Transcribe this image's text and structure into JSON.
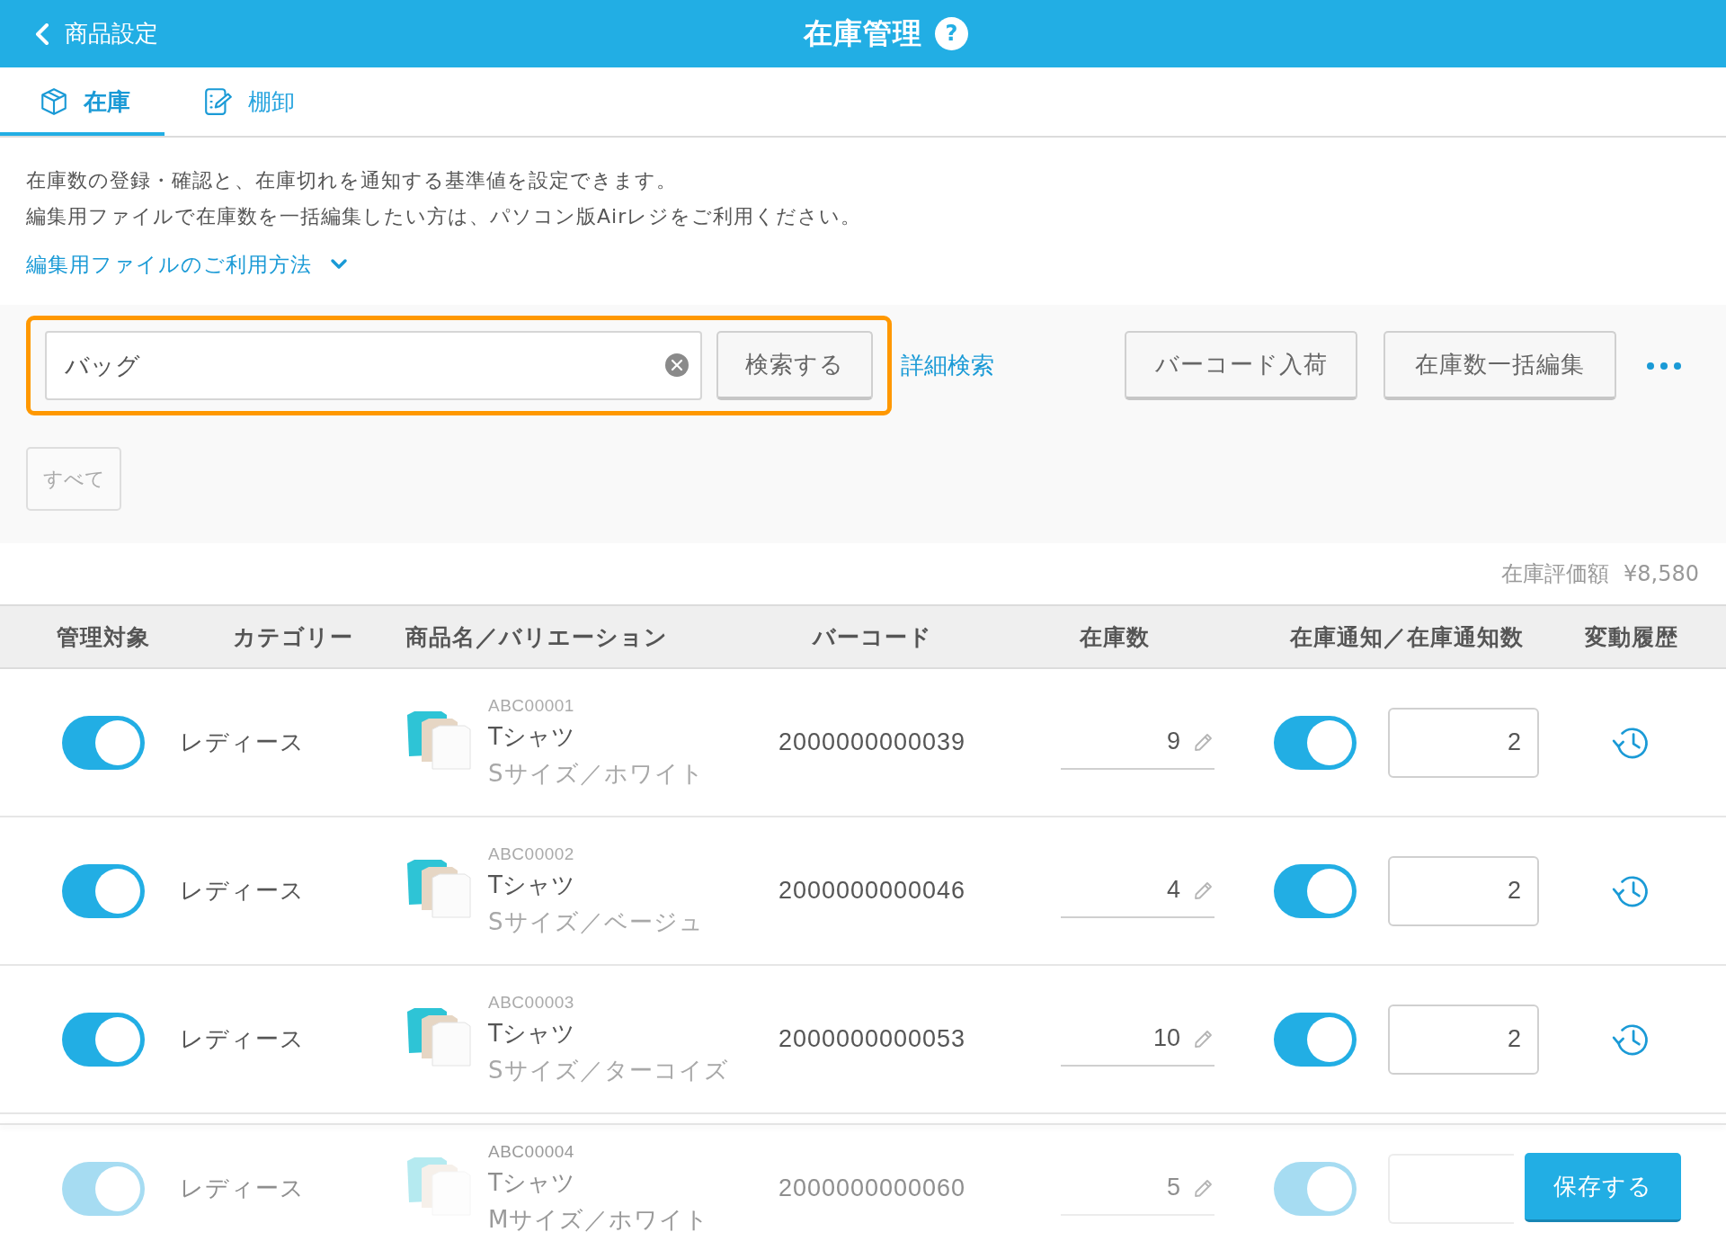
{
  "header": {
    "back": "商品設定",
    "title": "在庫管理",
    "help": "?"
  },
  "tabs": [
    {
      "label": "在庫",
      "selected": true
    },
    {
      "label": "棚卸",
      "selected": false
    }
  ],
  "description": [
    "在庫数の登録・確認と、在庫切れを通知する基準値を設定できます。",
    "編集用ファイルで在庫数を一括編集したい方は、パソコン版Airレジをご利用ください。"
  ],
  "help_link": {
    "label": "編集用ファイルのご利用方法",
    "expanded": false
  },
  "search": {
    "value": "バッグ",
    "button": "検索する",
    "highlighted": true
  },
  "advanced_search": "詳細検索",
  "actions": [
    "バーコード入荷",
    "在庫数一括編集"
  ],
  "filter_chips": [
    "すべて"
  ],
  "valuation": {
    "label": "在庫評価額",
    "amount": "¥8,580"
  },
  "table": {
    "columns": [
      "管理対象",
      "カテゴリー",
      "商品名／バリエーション",
      "バーコード",
      "在庫数",
      "在庫通知／在庫通知数",
      "変動履歴"
    ],
    "rows": [
      {
        "managed": true,
        "category": "レディース",
        "code": "ABC00001",
        "name": "Tシャツ",
        "variation": "Sサイズ／ホワイト",
        "barcode": "2000000000039",
        "stock": "9",
        "notify": true,
        "notify_count": "2"
      },
      {
        "managed": true,
        "category": "レディース",
        "code": "ABC00002",
        "name": "Tシャツ",
        "variation": "Sサイズ／ベージュ",
        "barcode": "2000000000046",
        "stock": "4",
        "notify": true,
        "notify_count": "2"
      },
      {
        "managed": true,
        "category": "レディース",
        "code": "ABC00003",
        "name": "Tシャツ",
        "variation": "Sサイズ／ターコイズ",
        "barcode": "2000000000053",
        "stock": "10",
        "notify": true,
        "notify_count": "2"
      },
      {
        "managed": true,
        "category": "レディース",
        "code": "ABC00004",
        "name": "Tシャツ",
        "variation": "Mサイズ／ホワイト",
        "barcode": "2000000000060",
        "stock": "5",
        "notify": true
      }
    ]
  },
  "footer": {
    "save_button": "保存する"
  }
}
